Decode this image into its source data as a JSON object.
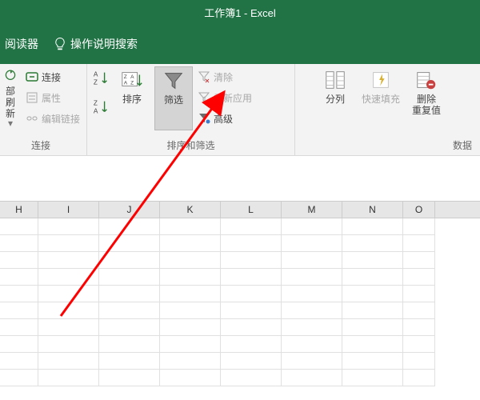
{
  "titlebar": {
    "text": "工作簿1 - Excel"
  },
  "tabs": {
    "reader": "阅读器",
    "tellme": "操作说明搜索"
  },
  "ribbon": {
    "group_conn": {
      "refresh": "部刷新",
      "connections": "连接",
      "properties": "属性",
      "edit_links": "编辑链接",
      "label": "连接"
    },
    "group_sort": {
      "sort": "排序",
      "filter": "筛选",
      "clear": "清除",
      "reapply": "重新应用",
      "advanced": "高级",
      "label": "排序和筛选"
    },
    "group_tools": {
      "text_to_cols": "分列",
      "flash_fill": "快速填充",
      "remove_dup1": "删除",
      "remove_dup2": "重复值",
      "label": "数据"
    }
  },
  "columns": [
    "H",
    "I",
    "J",
    "K",
    "L",
    "M",
    "N",
    "O"
  ]
}
